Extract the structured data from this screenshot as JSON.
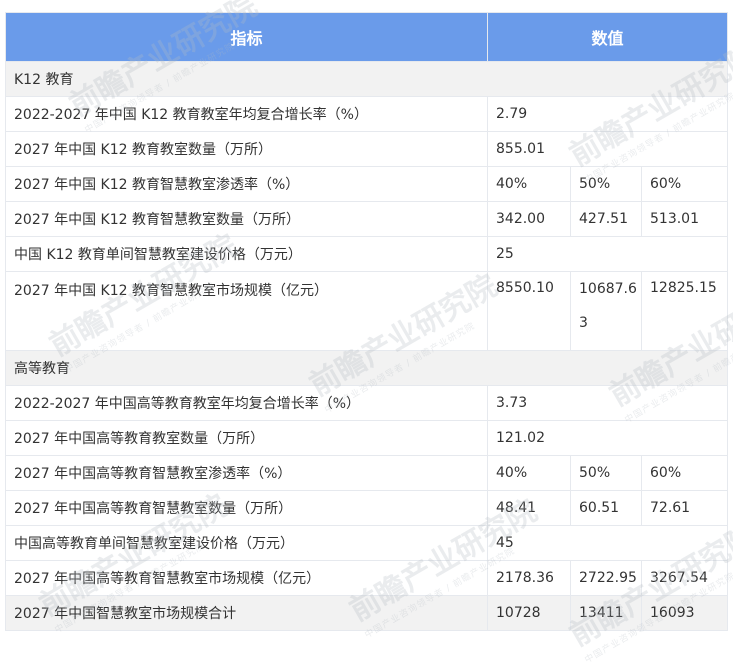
{
  "header": {
    "indicator": "指标",
    "value": "数值"
  },
  "sections": [
    {
      "title": "K12 教育",
      "rows": [
        {
          "label": "2022-2027 年中国 K12 教育教室年均复合增长率（%）",
          "values": [
            "2.79"
          ]
        },
        {
          "label": "2027 年中国 K12 教育教室数量（万所）",
          "values": [
            "855.01"
          ]
        },
        {
          "label": "2027 年中国 K12 教育智慧教室渗透率（%）",
          "values": [
            "40%",
            "50%",
            "60%"
          ]
        },
        {
          "label": "2027 年中国 K12 教育智慧教室数量（万所）",
          "values": [
            "342.00",
            "427.51",
            "513.01"
          ]
        },
        {
          "label": "中国 K12 教育单间智慧教室建设价格（万元）",
          "values": [
            "25"
          ]
        },
        {
          "label": "2027 年中国 K12 教育智慧教室市场规模（亿元）",
          "values": [
            "8550.10",
            "10687.63",
            "12825.15"
          ]
        }
      ]
    },
    {
      "title": "高等教育",
      "rows": [
        {
          "label": "2022-2027 年中国高等教育教室年均复合增长率（%）",
          "values": [
            "3.73"
          ]
        },
        {
          "label": "2027 年中国高等教育教室数量（万所）",
          "values": [
            "121.02"
          ]
        },
        {
          "label": "2027 年中国高等教育智慧教室渗透率（%）",
          "values": [
            "40%",
            "50%",
            "60%"
          ]
        },
        {
          "label": "2027 年中国高等教育智慧教室数量（万所）",
          "values": [
            "48.41",
            "60.51",
            "72.61"
          ]
        },
        {
          "label": "中国高等教育单间智慧教室建设价格（万元）",
          "values": [
            "45"
          ]
        },
        {
          "label": "2027 年中国高等教育智慧教室市场规模（亿元）",
          "values": [
            "2178.36",
            "2722.95",
            "3267.54"
          ]
        }
      ]
    }
  ],
  "total": {
    "label": "2027 年中国智慧教室市场规模合计",
    "values": [
      "10728",
      "13411",
      "16093"
    ]
  },
  "watermark": {
    "text": "前瞻产业研究院",
    "subtext": "中国产业咨询领导者 / 前瞻产业研究院"
  }
}
